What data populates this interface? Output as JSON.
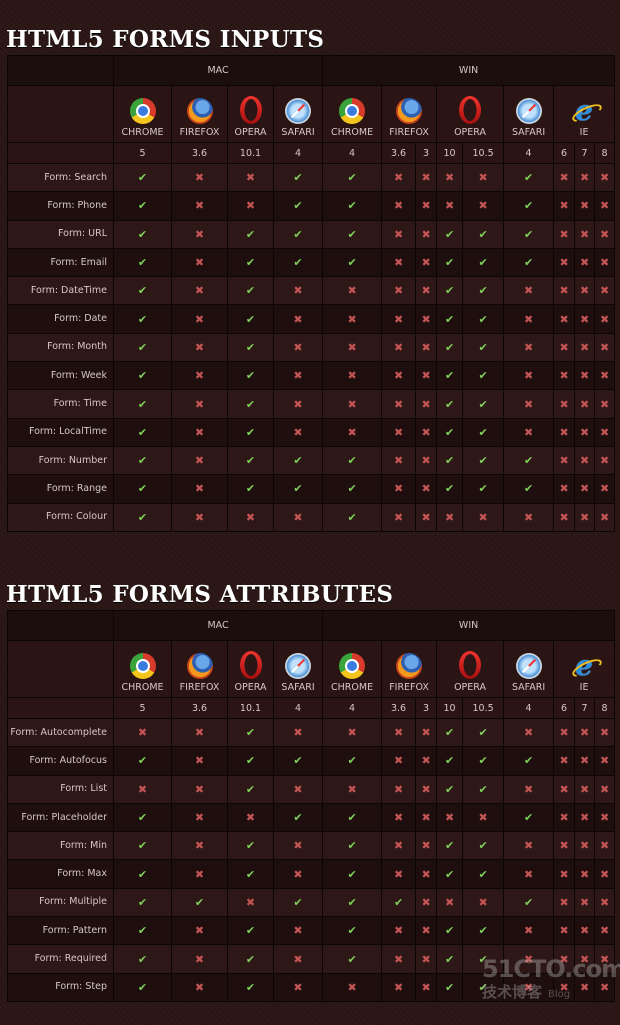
{
  "colors": {
    "check": "#7fcf5a",
    "cross": "#c25454",
    "background": "#2b1515",
    "title": "#ffffff"
  },
  "symbols": {
    "yes": "✔",
    "no": "✖"
  },
  "header": {
    "platforms": [
      {
        "label": "MAC",
        "span": 4
      },
      {
        "label": "WIN",
        "span": 9
      }
    ],
    "browsers": [
      {
        "name": "CHROME",
        "icon": "chrome",
        "span": 1
      },
      {
        "name": "FIREFOX",
        "icon": "firefox",
        "span": 1
      },
      {
        "name": "OPERA",
        "icon": "opera",
        "span": 1
      },
      {
        "name": "SAFARI",
        "icon": "safari",
        "span": 1
      },
      {
        "name": "CHROME",
        "icon": "chrome",
        "span": 1
      },
      {
        "name": "FIREFOX",
        "icon": "firefox",
        "span": 2
      },
      {
        "name": "OPERA",
        "icon": "opera",
        "span": 2
      },
      {
        "name": "SAFARI",
        "icon": "safari",
        "span": 1
      },
      {
        "name": "IE",
        "icon": "ie",
        "span": 3
      }
    ],
    "versions": [
      "5",
      "3.6",
      "10.1",
      "4",
      "4",
      "3.6",
      "3",
      "10",
      "10.5",
      "4",
      "6",
      "7",
      "8"
    ]
  },
  "tables": [
    {
      "title": "HTML5 FORMS INPUTS",
      "rows": [
        {
          "label": "Form: Search",
          "support": [
            1,
            0,
            0,
            1,
            1,
            0,
            0,
            0,
            0,
            1,
            0,
            0,
            0
          ]
        },
        {
          "label": "Form: Phone",
          "support": [
            1,
            0,
            0,
            1,
            1,
            0,
            0,
            0,
            0,
            1,
            0,
            0,
            0
          ]
        },
        {
          "label": "Form: URL",
          "support": [
            1,
            0,
            1,
            1,
            1,
            0,
            0,
            1,
            1,
            1,
            0,
            0,
            0
          ]
        },
        {
          "label": "Form: Email",
          "support": [
            1,
            0,
            1,
            1,
            1,
            0,
            0,
            1,
            1,
            1,
            0,
            0,
            0
          ]
        },
        {
          "label": "Form: DateTime",
          "support": [
            1,
            0,
            1,
            0,
            0,
            0,
            0,
            1,
            1,
            0,
            0,
            0,
            0
          ]
        },
        {
          "label": "Form: Date",
          "support": [
            1,
            0,
            1,
            0,
            0,
            0,
            0,
            1,
            1,
            0,
            0,
            0,
            0
          ]
        },
        {
          "label": "Form: Month",
          "support": [
            1,
            0,
            1,
            0,
            0,
            0,
            0,
            1,
            1,
            0,
            0,
            0,
            0
          ]
        },
        {
          "label": "Form: Week",
          "support": [
            1,
            0,
            1,
            0,
            0,
            0,
            0,
            1,
            1,
            0,
            0,
            0,
            0
          ]
        },
        {
          "label": "Form: Time",
          "support": [
            1,
            0,
            1,
            0,
            0,
            0,
            0,
            1,
            1,
            0,
            0,
            0,
            0
          ]
        },
        {
          "label": "Form: LocalTime",
          "support": [
            1,
            0,
            1,
            0,
            0,
            0,
            0,
            1,
            1,
            0,
            0,
            0,
            0
          ]
        },
        {
          "label": "Form: Number",
          "support": [
            1,
            0,
            1,
            1,
            1,
            0,
            0,
            1,
            1,
            1,
            0,
            0,
            0
          ]
        },
        {
          "label": "Form: Range",
          "support": [
            1,
            0,
            1,
            1,
            1,
            0,
            0,
            1,
            1,
            1,
            0,
            0,
            0
          ]
        },
        {
          "label": "Form: Colour",
          "support": [
            1,
            0,
            0,
            0,
            1,
            0,
            0,
            0,
            0,
            0,
            0,
            0,
            0
          ]
        }
      ]
    },
    {
      "title": "HTML5 FORMS ATTRIBUTES",
      "rows": [
        {
          "label": "Form: Autocomplete",
          "support": [
            0,
            0,
            1,
            0,
            0,
            0,
            0,
            1,
            1,
            0,
            0,
            0,
            0
          ]
        },
        {
          "label": "Form: Autofocus",
          "support": [
            1,
            0,
            1,
            1,
            1,
            0,
            0,
            1,
            1,
            1,
            0,
            0,
            0
          ]
        },
        {
          "label": "Form: List",
          "support": [
            0,
            0,
            1,
            0,
            0,
            0,
            0,
            1,
            1,
            0,
            0,
            0,
            0
          ]
        },
        {
          "label": "Form: Placeholder",
          "support": [
            1,
            0,
            0,
            1,
            1,
            0,
            0,
            0,
            0,
            1,
            0,
            0,
            0
          ]
        },
        {
          "label": "Form: Min",
          "support": [
            1,
            0,
            1,
            0,
            1,
            0,
            0,
            1,
            1,
            0,
            0,
            0,
            0
          ]
        },
        {
          "label": "Form: Max",
          "support": [
            1,
            0,
            1,
            0,
            1,
            0,
            0,
            1,
            1,
            0,
            0,
            0,
            0
          ]
        },
        {
          "label": "Form: Multiple",
          "support": [
            1,
            1,
            0,
            1,
            1,
            1,
            0,
            0,
            0,
            1,
            0,
            0,
            0
          ]
        },
        {
          "label": "Form: Pattern",
          "support": [
            1,
            0,
            1,
            0,
            1,
            0,
            0,
            1,
            1,
            0,
            0,
            0,
            0
          ]
        },
        {
          "label": "Form: Required",
          "support": [
            1,
            0,
            1,
            0,
            1,
            0,
            0,
            1,
            1,
            0,
            0,
            0,
            0
          ]
        },
        {
          "label": "Form: Step",
          "support": [
            1,
            0,
            1,
            0,
            0,
            0,
            0,
            1,
            1,
            0,
            0,
            0,
            0
          ]
        }
      ]
    }
  ],
  "watermark": {
    "line1": "51CTO.com",
    "line2": "技术博客",
    "line3": "Blog"
  }
}
